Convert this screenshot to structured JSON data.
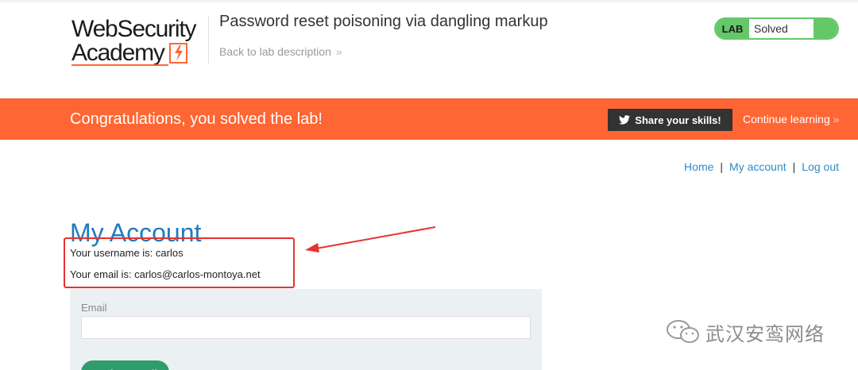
{
  "header": {
    "logo_line1": "WebSecurity",
    "logo_line2": "Academy",
    "lab_title": "Password reset poisoning via dangling markup",
    "back_link": "Back to lab description",
    "status": {
      "tag": "LAB",
      "text": "Solved",
      "color": "#64c869"
    }
  },
  "banner": {
    "message": "Congratulations, you solved the lab!",
    "share_label": "Share your skills!",
    "continue_label": "Continue learning",
    "color": "#ff6633"
  },
  "nav": {
    "home": "Home",
    "my_account": "My account",
    "log_out": "Log out",
    "separator": "|"
  },
  "main": {
    "title": "My Account",
    "username_line": "Your username is: carlos",
    "email_line": "Your email is: carlos@carlos-montoya.net",
    "form": {
      "email_label": "Email",
      "email_value": "",
      "update_button": "Update email"
    }
  },
  "watermark": {
    "text": "武汉安鸾网络"
  },
  "colors": {
    "accent_orange": "#ff6633",
    "link_blue": "#2f8ac7",
    "title_blue": "#1f7bbf",
    "highlight_red": "#e83232",
    "button_green": "#2e9c6b"
  }
}
